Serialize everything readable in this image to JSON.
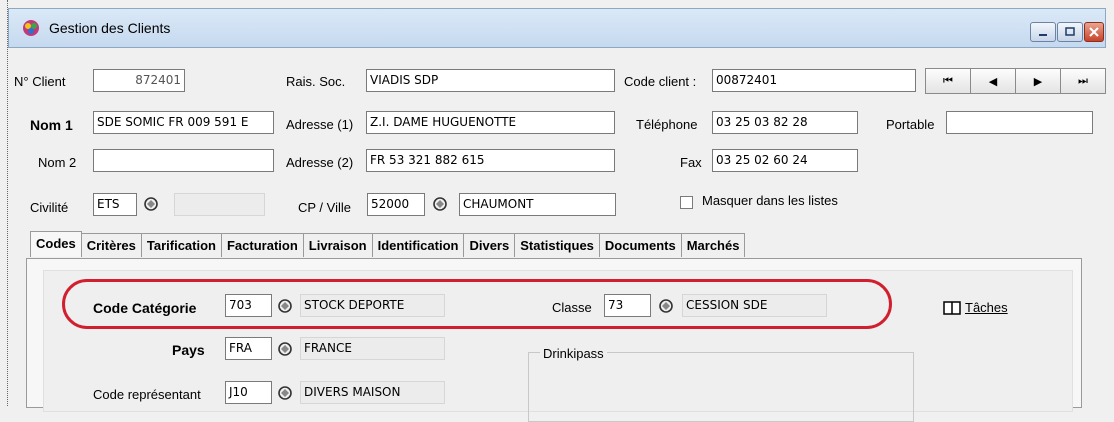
{
  "window": {
    "title": "Gestion des Clients"
  },
  "nav": {
    "first": "⏮",
    "prev": "◀",
    "next": "▶",
    "last": "⏭"
  },
  "labels": {
    "num_client": "N° Client",
    "rais_soc": "Rais. Soc.",
    "code_client": "Code client :",
    "nom1": "Nom 1",
    "adresse1": "Adresse (1)",
    "telephone": "Téléphone",
    "portable": "Portable",
    "nom2": "Nom 2",
    "adresse2": "Adresse (2)",
    "fax": "Fax",
    "civilite": "Civilité",
    "cp_ville": "CP / Ville",
    "masquer": "Masquer dans les listes"
  },
  "values": {
    "num_client": "872401",
    "rais_soc": "VIADIS SDP",
    "code_client": "00872401",
    "nom1": "SDE SOMIC FR 009 591 E",
    "adresse1": "Z.I. DAME HUGUENOTTE",
    "telephone": "03 25 03 82 28",
    "portable": "",
    "nom2": "",
    "adresse2": "FR 53 321 882 615",
    "fax": "03 25 02 60 24",
    "civilite": "ETS",
    "civilite_desc": "",
    "cp": "52000",
    "ville": "CHAUMONT"
  },
  "tabs": [
    "Codes",
    "Critères",
    "Tarification",
    "Facturation",
    "Livraison",
    "Identification",
    "Divers",
    "Statistiques",
    "Documents",
    "Marchés"
  ],
  "codes_tab": {
    "code_categorie_label": "Code Catégorie",
    "code_categorie": "703",
    "code_categorie_desc": "STOCK DEPORTE",
    "classe_label": "Classe",
    "classe": "73",
    "classe_desc": "CESSION SDE",
    "taches": "Tâches",
    "pays_label": "Pays",
    "pays": "FRA",
    "pays_desc": "FRANCE",
    "drinkipass": "Drinkipass",
    "code_rep_label": "Code représentant",
    "code_rep": "J10",
    "code_rep_desc": "DIVERS MAISON"
  },
  "colors": {
    "highlight_oval": "#d0202f",
    "titlebar": "#c5d9ef"
  },
  "icons": [
    "app-icon",
    "lookup-icon",
    "book-icon",
    "minimize-icon",
    "maximize-icon",
    "close-icon"
  ]
}
